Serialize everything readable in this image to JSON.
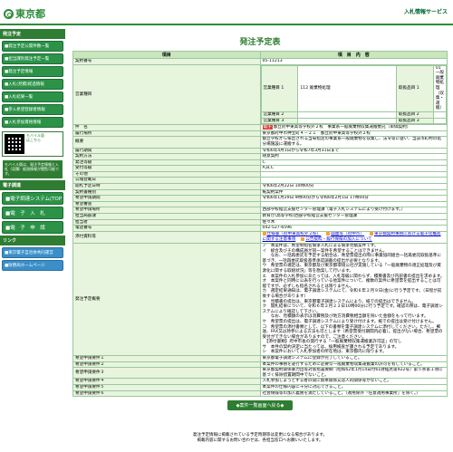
{
  "header": {
    "logo_text": "東京都",
    "site_name": "入札情報サービス"
  },
  "sidebar": {
    "section1_title": "発注予定",
    "items": [
      "■発注予定公開件数一覧",
      "■担当課別発注予定一覧",
      "■発注予定情報",
      "■入札(見積)経過情報",
      "■入札結果一覧",
      "■参入希望登録者情報",
      "■入札参加資格情報"
    ],
    "mobile_label": "モバイル版",
    "mobile_sub": "はこちら",
    "mobile_desc": "モバイル版は、発注予定情報と入札（見積）経過情報が閲覧可能です。",
    "section2_title": "電子調達",
    "big_items": [
      "■電子調達システム(TOP)",
      "■電　子　入　札",
      "■電　子　申　請"
    ],
    "section3_title": "リンク",
    "links": [
      "■東京電子自治体共同運営",
      "■財務局ホームページ"
    ]
  },
  "main": {
    "title": "発注予定表",
    "col_item": "項目",
    "col_content": "項　目　内　容",
    "contract_no_label": "契約番号",
    "contract_no": "05-11213",
    "biz_category_label": "営業種目",
    "biz_items": [
      [
        "営業種目 1",
        "112 廃棄物処理",
        "取扱品目 1",
        "01 一般廃棄物処理（収集・運搬）"
      ],
      [
        "営業種目 2",
        "",
        "取扱品目 2",
        ""
      ],
      [
        "営業種目 3",
        "",
        "取扱品目 3",
        ""
      ]
    ],
    "rows": [
      {
        "label": "件　名",
        "value": "都立府中東高等学校外２校　事業系一般廃棄物収集運搬委託（単価契約）",
        "tag": "電子"
      },
      {
        "label": "履行場所",
        "value": "東京都府中市押立町４－２１　都立府中東高等学校外２校"
      },
      {
        "label": "概要",
        "value": "都立学校から排出される当局指定の事業系一般廃棄物を収集し、法令等に従い、当該市町村の処分場施設に運搬する。"
      },
      {
        "label": "履行期間",
        "value": "令和6年4月1日から令和7年3月31日まで"
      },
      {
        "label": "契約方法",
        "value": "随意契約"
      },
      {
        "label": "発注等級",
        "value": "C"
      },
      {
        "label": "受付等級",
        "value": "A,B,C"
      },
      {
        "label": "その他",
        "value": ""
      },
      {
        "label": "公報登載日",
        "value": ""
      },
      {
        "label": "開札予定日時",
        "value": "令和6年2月22日 10時00分"
      },
      {
        "label": "契約書種別",
        "value": "紙契約案件"
      },
      {
        "label": "希望申請期間",
        "value": "令和6年1月29日 9時00分から令和6年2月1日 17時00分"
      },
      {
        "label": "希望審査",
        "value": ""
      },
      {
        "label": "希望申請場所",
        "value": "西部学校経営支援センター管理課（電子入札システムにより受け付けます。）"
      },
      {
        "label": "担当局部課",
        "value": "教育庁(高等学校)西部学校経営支援センター管理課"
      },
      {
        "label": "担当者",
        "value": "佐々木"
      },
      {
        "label": "電話番号",
        "value": "042-527-6596"
      }
    ],
    "attach_label": "添付資料等",
    "attach_links": [
      "仕様書（府中東高校外２校）",
      "図面等（府中市）",
      "東京都契約事務における電子化推進に関する注意事項",
      "公告抜粋・履行保険の加入について"
    ],
    "notes_label": "発注予定概要",
    "notes": "ア　本案件は、希望制指名競争入札による競争見積案件です。\nイ　総合及びその構成員が同一案件を希望することはできません。\n　　なお、一括再委託を予定する組合は、希望票提出の際に事業協同組合一括再委託取扱基準に基づき、一括再委託取扱基準承認調書の提出が必要となります。\nウ　希望票の選定は、東京都及び東京都環境公社が実施している「一般廃棄物の適正処理及び資源化に関する取組状況」等を勘案して行います。\nエ　本案件の入札参加にあたっては、入札等級に関わらず、積算書及び内訳書の提出を求めます。\nオ　本案件と同時に公表を行っている他案件について、複数の案件に希望票を提出することは可能ですが、必ずしも指名されるとは限りません。\nカ　選定結果通知は、電子調達システムにて、令和６年２月９日(金)に行う予定です。（日程が前後する場合があります）\nキ　見積書の提出は、東京都電子調達システムにより、紙での提出はできません。\nク　開札結果について、令和６年２月２２日10時00分に行う予定です。確認の際は、電子調達システムにより確認して下さい。\n　　なお、見積額の表示は消費税及び地方消費税相当額を除いた金額をもって行います。\nケ　希望票の提出は、電子調達システムにより受け付けます。紙での提出は受け付けません。\nコ　希望票の添付書類として、以下の書類を電子調達システムに添付してください。ただし、郵送、FAX又は持参による方法も可とします（希望票受付期間内必着）。提出がない場合、希望票の受付ができない場合がありますので、ご注意ください。\n　【添付書類】府中市長の発行する「一般廃棄物収集運搬業許可証」の写し\nサ　本件の契約決定に当たっては、採用検査が課される予定であります。\nシ　本案件において入札参加者の所在地は、東京都内に限ります。",
    "extra_rows": [
      {
        "label": "希望申請要件１",
        "value": "東京都電子調達システムに登録が完了していること。"
      },
      {
        "label": "希望申請要件２",
        "value": "本案件の事務を遂行するために必要な一般廃棄物収集運搬業の許可を有していること。"
      },
      {
        "label": "希望申請要件３",
        "value": "東京都契約関係暴力団等対策措置要綱（昭和62年1月14日付61財経庶第922号）第５条第１項に基づく排除措置期間中でないこと。"
      },
      {
        "label": "希望申請要件４",
        "value": "入札参加しようとする者の間に資本関係又は人的関係等がないこと。"
      },
      {
        "label": "希望申請要件５",
        "value": "本案件の仕様内容に十分に対応できること。"
      },
      {
        "label": "希望申請要件６",
        "value": "社会保険等の加入義務を満たしていること。（適用除外「任意適用事業所」を除く。）"
      }
    ],
    "back_label": "◆案件一覧画面へ戻る◆"
  },
  "footer": {
    "line1": "発注予定情報に掲載されている予定時期等は変更になる場合があります。",
    "line2": "掲載内容に関するお問い合わせは、各担当窓口へお願いいたします。"
  }
}
